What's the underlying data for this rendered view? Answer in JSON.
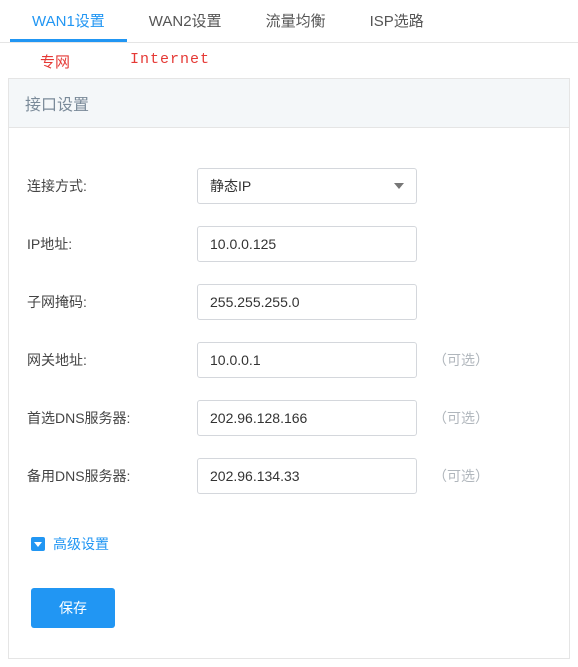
{
  "tabs": [
    "WAN1设置",
    "WAN2设置",
    "流量均衡",
    "ISP选路"
  ],
  "activeTab": 0,
  "subtabs": {
    "left": "专网",
    "right": "Internet"
  },
  "panel": {
    "title": "接口设置"
  },
  "form": {
    "connection": {
      "label": "连接方式:",
      "value": "静态IP"
    },
    "ip": {
      "label": "IP地址:",
      "value": "10.0.0.125"
    },
    "mask": {
      "label": "子网掩码:",
      "value": "255.255.255.0"
    },
    "gateway": {
      "label": "网关地址:",
      "value": "10.0.0.1",
      "optional": "（可选）"
    },
    "dns1": {
      "label": "首选DNS服务器:",
      "value": "202.96.128.166",
      "optional": "（可选）"
    },
    "dns2": {
      "label": "备用DNS服务器:",
      "value": "202.96.134.33",
      "optional": "（可选）"
    }
  },
  "advanced": "高级设置",
  "save": "保存"
}
